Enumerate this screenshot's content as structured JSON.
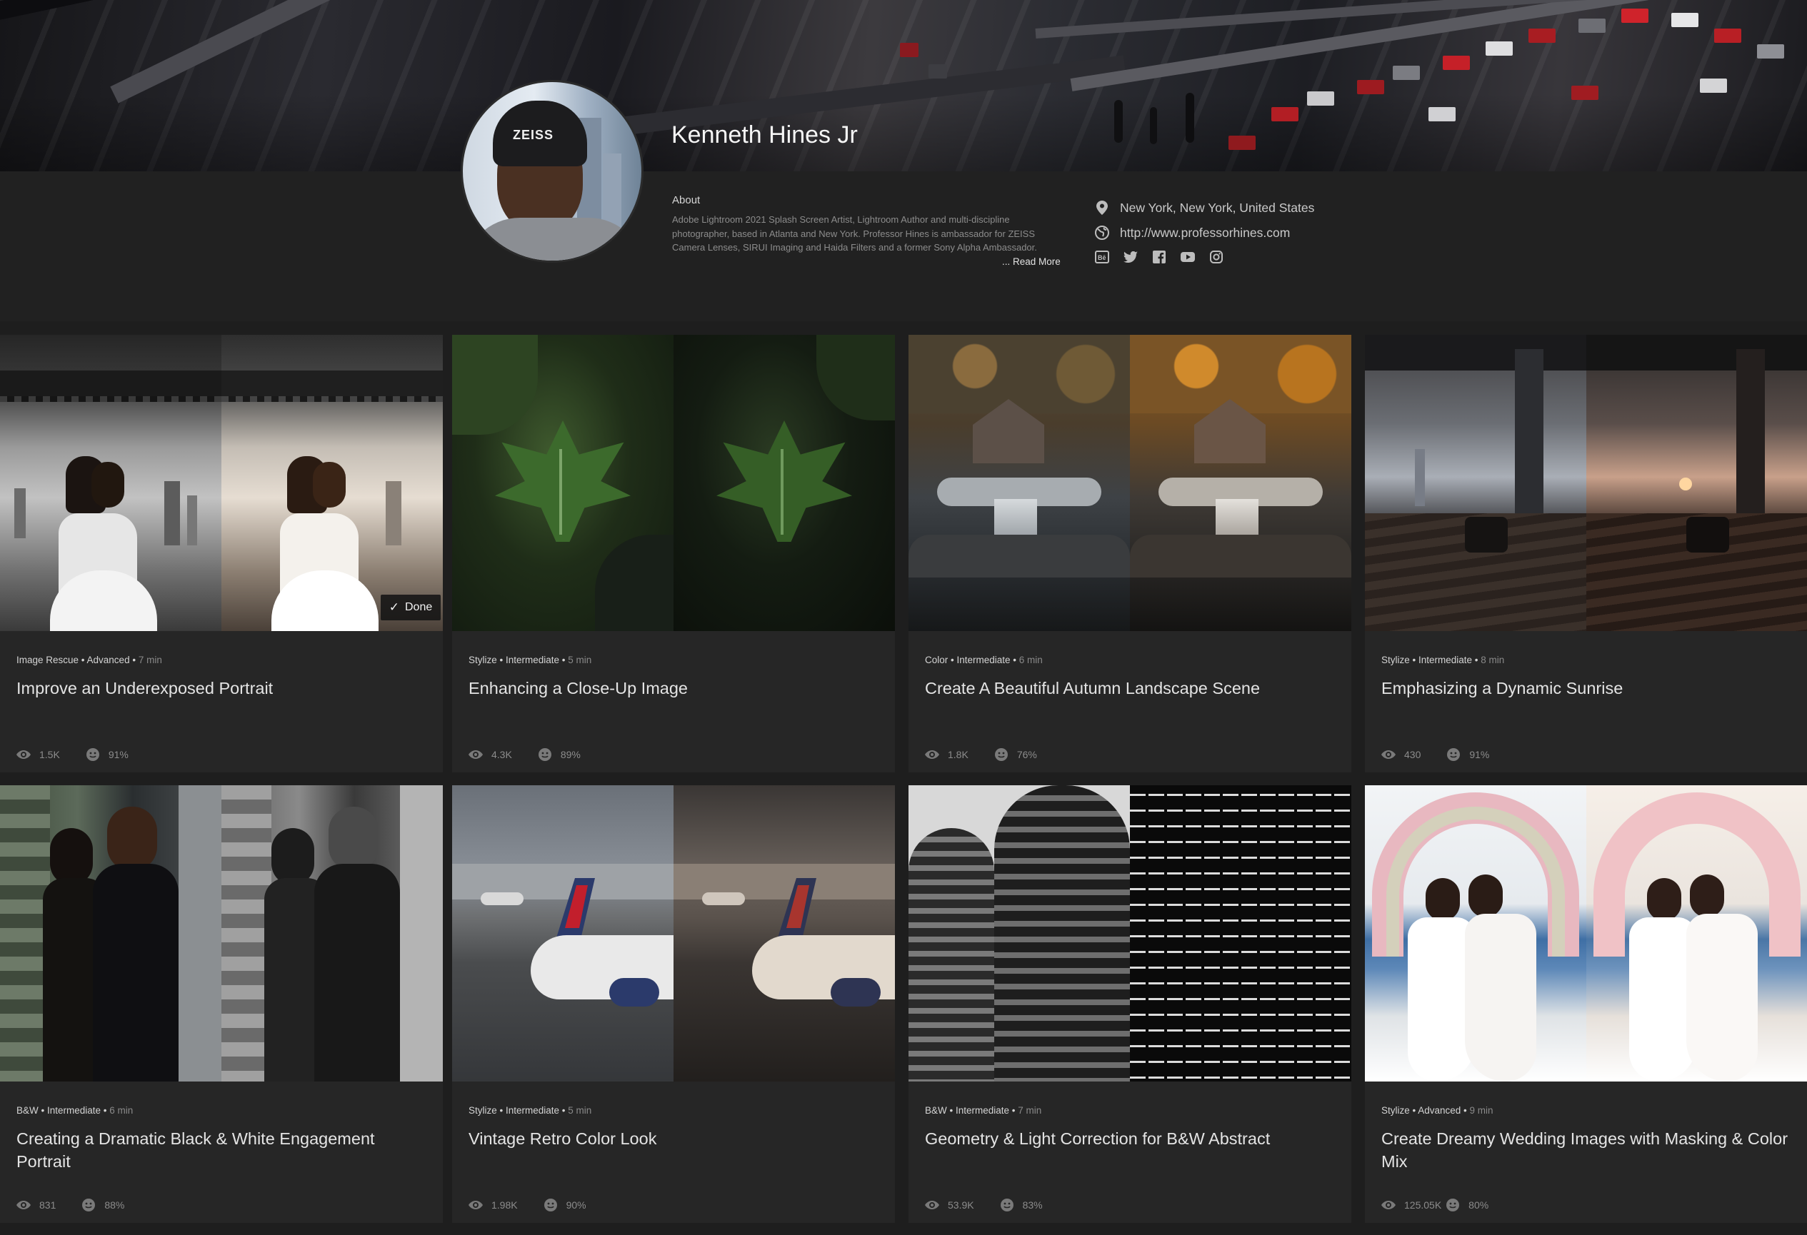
{
  "profile": {
    "name": "Kenneth Hines Jr",
    "about_label": "About",
    "about_text": "Adobe Lightroom 2021 Splash Screen Artist, Lightroom Author and multi-discipline photographer, based in Atlanta and New York. Professor Hines is ambassador for ZEISS Camera Lenses, SIRUI Imaging and Haida Filters and a former Sony Alpha Ambassador.",
    "read_more": "... Read More",
    "location": "New York, New York, United States",
    "website": "http://www.professorhines.com",
    "avatar_text": "ZEISS",
    "social_icons": [
      "behance-icon",
      "twitter-icon",
      "facebook-icon",
      "youtube-icon",
      "instagram-icon"
    ]
  },
  "tutorials": [
    {
      "category": "Image Rescue",
      "level": "Advanced",
      "duration": "7 min",
      "title": "Improve an Underexposed Portrait",
      "views": "1.5K",
      "rating": "91%",
      "done_label": "Done"
    },
    {
      "category": "Stylize",
      "level": "Intermediate",
      "duration": "5 min",
      "title": "Enhancing a Close-Up Image",
      "views": "4.3K",
      "rating": "89%"
    },
    {
      "category": "Color",
      "level": "Intermediate",
      "duration": "6 min",
      "title": "Create A Beautiful Autumn Landscape Scene",
      "views": "1.8K",
      "rating": "76%"
    },
    {
      "category": "Stylize",
      "level": "Intermediate",
      "duration": "8 min",
      "title": "Emphasizing a Dynamic Sunrise",
      "views": "430",
      "rating": "91%"
    },
    {
      "category": "B&W",
      "level": "Intermediate",
      "duration": "6 min",
      "title": "Creating a Dramatic Black & White Engagement Portrait",
      "views": "831",
      "rating": "88%"
    },
    {
      "category": "Stylize",
      "level": "Intermediate",
      "duration": "5 min",
      "title": "Vintage Retro Color Look",
      "views": "1.98K",
      "rating": "90%"
    },
    {
      "category": "B&W",
      "level": "Intermediate",
      "duration": "7 min",
      "title": "Geometry & Light Correction for B&W Abstract",
      "views": "53.9K",
      "rating": "83%"
    },
    {
      "category": "Stylize",
      "level": "Advanced",
      "duration": "9 min",
      "title": "Create Dreamy Wedding Images with Masking & Color Mix",
      "views": "125.05K",
      "rating": "80%"
    }
  ],
  "colors": {
    "page_bg": "#1e1e1e",
    "card_bg": "#262626",
    "text_primary": "#e4e4e4",
    "text_muted": "#8c8c8c"
  }
}
